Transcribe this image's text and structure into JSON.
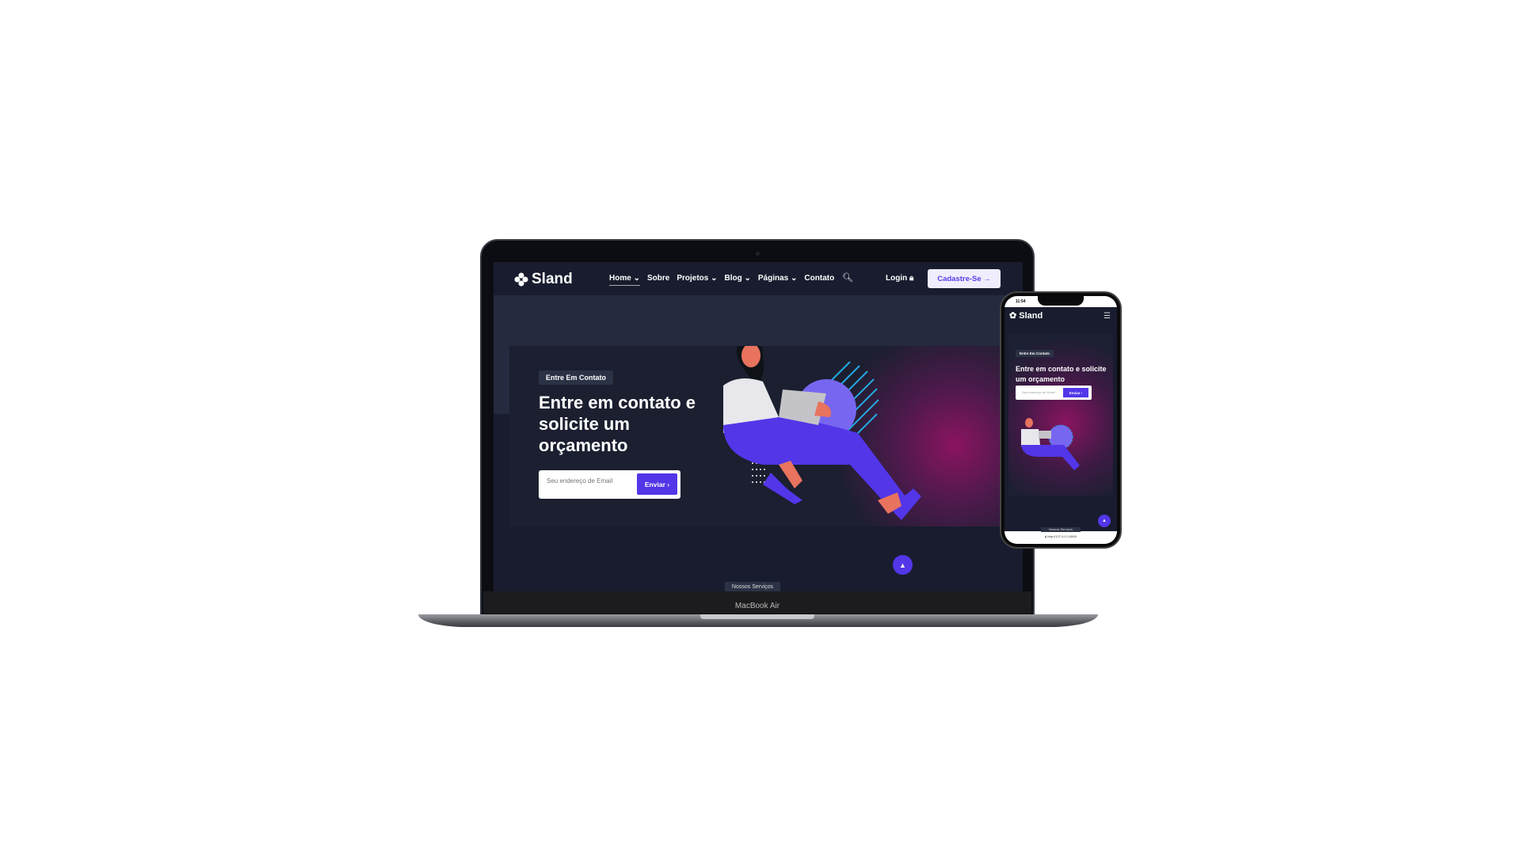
{
  "laptop": {
    "model_label": "MacBook Air",
    "site": {
      "logo": "Sland",
      "nav": [
        {
          "label": "Home",
          "dropdown": true,
          "active": true
        },
        {
          "label": "Sobre",
          "dropdown": false
        },
        {
          "label": "Projetos",
          "dropdown": true
        },
        {
          "label": "Blog",
          "dropdown": true
        },
        {
          "label": "Páginas",
          "dropdown": true
        },
        {
          "label": "Contato",
          "dropdown": false
        }
      ],
      "search_icon": "search-icon",
      "login_label": "Login",
      "signup_label": "Cadastre-Se",
      "hero": {
        "badge": "Entre Em Contato",
        "title": "Entre em contato e solicite um orçamento",
        "email_placeholder": "Seu endereço de Email",
        "submit_label": "Enviar"
      },
      "next_section_label": "Nossos Serviços"
    }
  },
  "phone": {
    "time": "11:54",
    "logo": "Sland",
    "hero": {
      "badge": "Entre Em Contato",
      "title": "Entre em contato e solicite um orçamento",
      "email_placeholder": "Seu endereço de Email",
      "submit_label": "Enviar"
    },
    "next_section_label": "Nossos Serviços",
    "url": "http://127.0.0.1:5500"
  },
  "colors": {
    "accent": "#5236e8",
    "background": "#181c2e",
    "glow": "#8a1460"
  }
}
